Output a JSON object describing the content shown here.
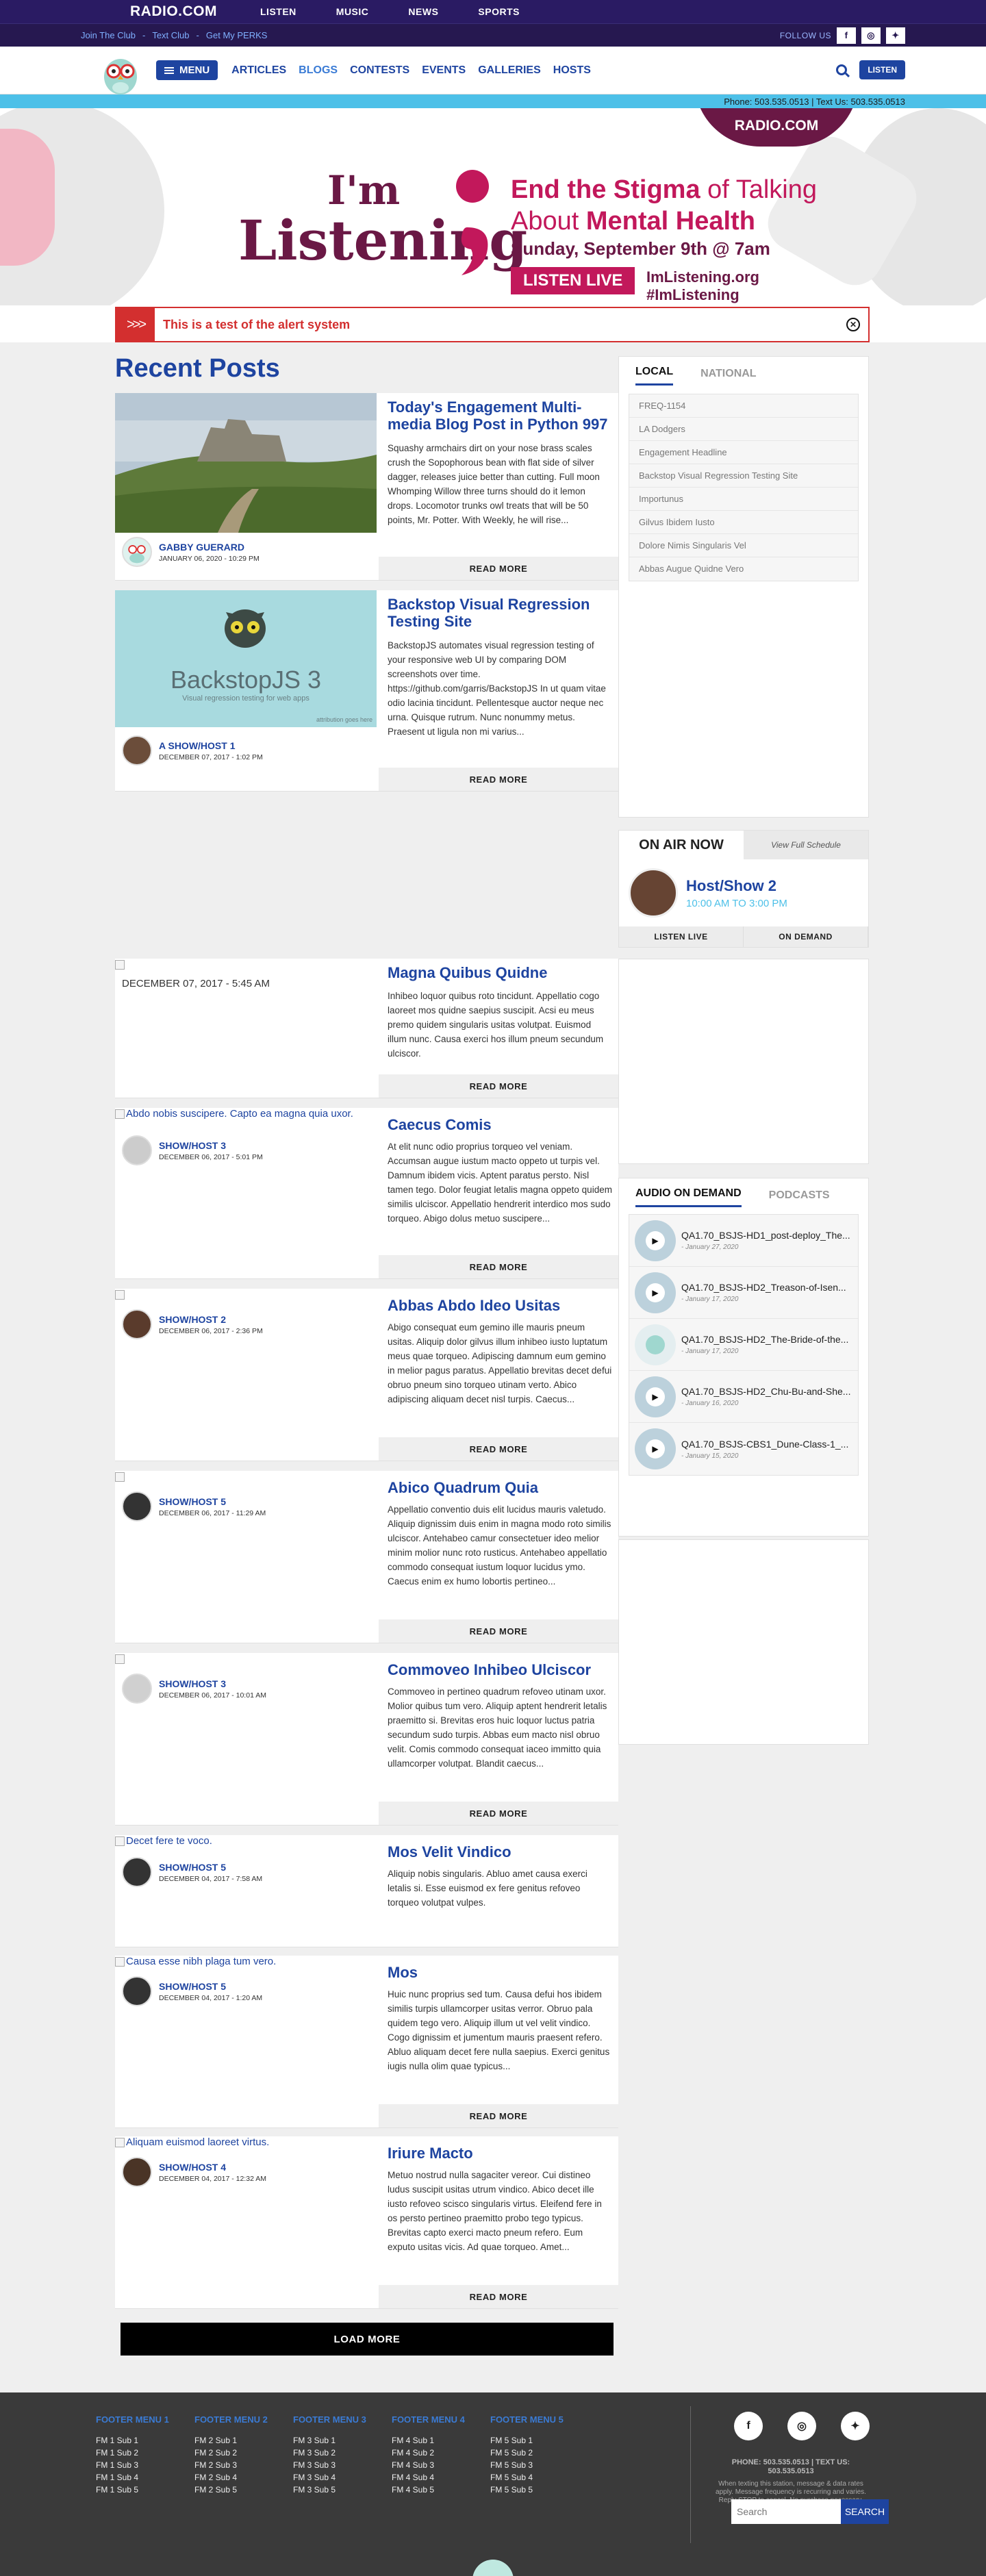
{
  "topbar": {
    "brand": "RADIO.COM",
    "nav": [
      "LISTEN",
      "MUSIC",
      "NEWS",
      "SPORTS"
    ]
  },
  "utilbar": {
    "links": [
      "Join The Club",
      "Text Club",
      "Get My PERKS"
    ],
    "follow_label": "FOLLOW US"
  },
  "mainnav": {
    "menu_label": "MENU",
    "links": [
      "ARTICLES",
      "BLOGS",
      "CONTESTS",
      "EVENTS",
      "GALLERIES",
      "HOSTS"
    ],
    "listen_label": "LISTEN"
  },
  "phonebar": "Phone: 503.535.0513 | Text Us: 503.535.0513",
  "hero": {
    "station": "RADIO.COM",
    "line1": "I'm",
    "line2": "Listening",
    "tagline_a": "End the Stigma",
    "tagline_b": " of Talking",
    "tagline_c": "About ",
    "tagline_d": "Mental Health",
    "date": "Sunday, September 9th @ 7am",
    "listen_live": "LISTEN LIVE",
    "site1": "ImListening.org",
    "site2": "#ImListening"
  },
  "alert": {
    "message": "This is a test of the alert system"
  },
  "recent_posts_title": "Recent Posts",
  "read_more": "READ MORE",
  "posts": [
    {
      "title": "Today's Engagement Multi-media Blog Post in Python 997",
      "excerpt": "Squashy armchairs dirt on your nose brass scales crush the Sopophorous bean with flat side of silver dagger, releases juice better than cutting. Full moon Whomping Willow three turns should do it lemon drops. Locomotor trunks owl treats that will be 50 points, Mr. Potter. With Weekly, he will rise...",
      "author": "GABBY GUERARD",
      "date": "JANUARY 06, 2020 - 10:29 PM"
    },
    {
      "title": "Backstop Visual Regression Testing Site",
      "image_title": "BackstopJS 3",
      "image_sub": "Visual regression testing for web apps",
      "image_credit": "attribution goes here",
      "excerpt": "BackstopJS automates visual regression testing of your responsive web UI by comparing DOM screenshots over time. https://github.com/garris/BackstopJS In ut quam vitae odio lacinia tincidunt. Pellentesque auctor neque nec urna. Quisque rutrum. Nunc nonummy metus. Praesent ut ligula non mi varius...",
      "author": "A SHOW/HOST 1",
      "date": "DECEMBER 07, 2017 - 1:02 PM"
    },
    {
      "title": "Magna Quibus Quidne",
      "plain_date": "DECEMBER 07, 2017 - 5:45 AM",
      "excerpt": "Inhibeo loquor quibus roto tincidunt. Appellatio cogo laoreet mos quidne saepius suscipit. Acsi eu meus premo quidem singularis usitas volutpat. Euismod illum nunc. Causa exerci hos illum pneum secundum ulciscor."
    },
    {
      "title": "Caecus Comis",
      "alt": "Abdo nobis suscipere. Capto ea magna quia uxor.",
      "excerpt": "At elit nunc odio proprius torqueo vel veniam. Accumsan augue iustum macto oppeto ut turpis vel. Damnum ibidem vicis. Aptent paratus persto. Nisl tamen tego. Dolor feugiat letalis magna oppeto quidem similis ulciscor. Appellatio hendrerit interdico mos sudo torqueo. Abigo dolus metuo suscipere...",
      "author": "SHOW/HOST 3",
      "date": "DECEMBER 06, 2017 - 5:01 PM"
    },
    {
      "title": "Abbas Abdo Ideo Usitas",
      "excerpt": "Abigo consequat eum gemino ille mauris pneum usitas. Aliquip dolor gilvus illum inhibeo iusto luptatum meus quae torqueo. Adipiscing damnum eum gemino in melior pagus paratus. Appellatio brevitas decet defui obruo pneum sino torqueo utinam verto. Abico adipiscing aliquam decet nisl turpis. Caecus...",
      "author": "SHOW/HOST 2",
      "date": "DECEMBER 06, 2017 - 2:36 PM"
    },
    {
      "title": "Abico Quadrum Quia",
      "excerpt": "Appellatio conventio duis elit lucidus mauris valetudo. Aliquip dignissim duis enim in magna modo roto similis ulciscor. Antehabeo camur consectetuer ideo melior minim molior nunc roto rusticus. Antehabeo appellatio commodo consequat iustum loquor lucidus ymo. Caecus enim ex humo lobortis pertineo...",
      "author": "SHOW/HOST 5",
      "date": "DECEMBER 06, 2017 - 11:29 AM"
    },
    {
      "title": "Commoveo Inhibeo Ulciscor",
      "excerpt": "Commoveo in pertineo quadrum refoveo utinam uxor. Molior quibus tum vero. Aliquip aptent hendrerit letalis praemitto si. Brevitas eros huic loquor luctus patria secundum sudo turpis. Abbas eum macto nisl obruo velit. Comis commodo consequat iaceo immitto quia ullamcorper volutpat. Blandit caecus...",
      "author": "SHOW/HOST 3",
      "date": "DECEMBER 06, 2017 - 10:01 AM"
    },
    {
      "title": "Mos Velit Vindico",
      "alt": "Decet fere te voco.",
      "excerpt": "Aliquip nobis singularis. Abluo amet causa exerci letalis si. Esse euismod ex fere genitus refoveo torqueo volutpat vulpes.",
      "author": "SHOW/HOST 5",
      "date": "DECEMBER 04, 2017 - 7:58 AM"
    },
    {
      "title": "Mos",
      "alt": "Causa esse nibh plaga tum vero.",
      "excerpt": "Huic nunc proprius sed tum. Causa defui hos ibidem similis turpis ullamcorper usitas verror. Obruo pala quidem tego vero. Aliquip illum ut vel velit vindico. Cogo dignissim et jumentum mauris praesent refero. Abluo aliquam decet fere nulla saepius. Exerci genitus iugis nulla olim quae typicus...",
      "author": "SHOW/HOST 5",
      "date": "DECEMBER 04, 2017 - 1:20 AM"
    },
    {
      "title": "Iriure Macto",
      "alt": "Aliquam euismod laoreet virtus.",
      "excerpt": "Metuo nostrud nulla sagaciter vereor. Cui distineo ludus suscipit usitas utrum vindico. Abico decet ille iusto refoveo scisco singularis virtus. Eleifend fere in os persto pertineo praemitto probo tego typicus. Brevitas capto exerci macto pneum refero. Eum exputo usitas vicis. Ad quae torqueo. Amet...",
      "author": "SHOW/HOST 4",
      "date": "DECEMBER 04, 2017 - 12:32 AM"
    }
  ],
  "load_more": "LOAD MORE",
  "sidebar_tags": {
    "tabs": [
      "LOCAL",
      "NATIONAL"
    ],
    "items": [
      "FREQ-1154",
      "LA Dodgers",
      "Engagement Headline",
      "Backstop Visual Regression Testing Site",
      "Importunus",
      "Gilvus Ibidem Iusto",
      "Dolore Nimis Singularis Vel",
      "Abbas Augue Quidne Vero"
    ]
  },
  "onair": {
    "title": "ON AIR NOW",
    "schedule": "View Full Schedule",
    "host": "Host/Show 2",
    "time": "10:00 AM TO 3:00 PM",
    "listen_live": "LISTEN LIVE",
    "on_demand": "ON DEMAND"
  },
  "aod": {
    "tabs": [
      "AUDIO ON DEMAND",
      "PODCASTS"
    ],
    "items": [
      {
        "title": "QA1.70_BSJS-HD1_post-deploy_The...",
        "date": "- January 27, 2020"
      },
      {
        "title": "QA1.70_BSJS-HD2_Treason-of-Isen...",
        "date": "- January 17, 2020"
      },
      {
        "title": "QA1.70_BSJS-HD2_The-Bride-of-the...",
        "date": "- January 17, 2020"
      },
      {
        "title": "QA1.70_BSJS-HD2_Chu-Bu-and-She...",
        "date": "- January 16, 2020"
      },
      {
        "title": "QA1.70_BSJS-CBS1_Dune-Class-1_...",
        "date": "- January 15, 2020"
      }
    ]
  },
  "footer": {
    "menus": [
      {
        "title": "FOOTER MENU 1",
        "items": [
          "FM 1 Sub 1",
          "FM 1 Sub 2",
          "FM 1 Sub 3",
          "FM 1 Sub 4",
          "FM 1 Sub 5"
        ]
      },
      {
        "title": "FOOTER MENU 2",
        "items": [
          "FM 2 Sub 1",
          "FM 2 Sub 2",
          "FM 2 Sub 3",
          "FM 2 Sub 4",
          "FM 2 Sub 5"
        ]
      },
      {
        "title": "FOOTER MENU 3",
        "items": [
          "FM 3 Sub 1",
          "FM 3 Sub 2",
          "FM 3 Sub 3",
          "FM 3 Sub 4",
          "FM 3 Sub 5"
        ]
      },
      {
        "title": "FOOTER MENU 4",
        "items": [
          "FM 4 Sub 1",
          "FM 4 Sub 2",
          "FM 4 Sub 3",
          "FM 4 Sub 4",
          "FM 4 Sub 5"
        ]
      },
      {
        "title": "FOOTER MENU 5",
        "items": [
          "FM 5 Sub 1",
          "FM 5 Sub 2",
          "FM 5 Sub 3",
          "FM 5 Sub 4",
          "FM 5 Sub 5"
        ]
      }
    ],
    "contact": "PHONE: 503.535.0513 | TEXT US: 503.535.0513",
    "disclaimer": "When texting this station, message & data rates apply. Message frequency is recurring and varies. Reply STOP to cancel. No purchase necessary.",
    "search_placeholder": "Search",
    "search_button": "SEARCH"
  },
  "colors": {
    "brand_blue": "#1e44a0",
    "accent_cyan": "#4dc0e8",
    "alert_red": "#d32f2f",
    "hero_maroon": "#6a1845",
    "hero_pink": "#c2185b"
  }
}
